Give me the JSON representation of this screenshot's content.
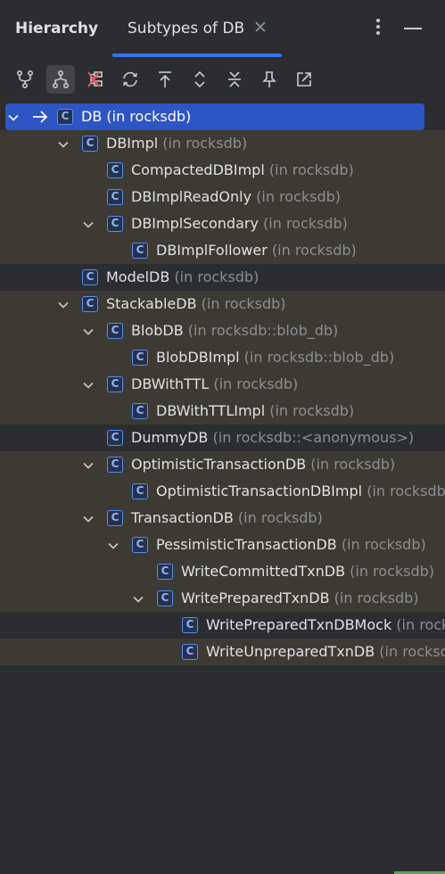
{
  "panel": {
    "title": "Hierarchy",
    "tab_label": "Subtypes of DB",
    "tab_close_icon": "close-icon",
    "more_icon": "more-vertical-icon",
    "minimize_icon": "minimize-icon"
  },
  "toolbar": [
    {
      "name": "supertypes-hierarchy-button",
      "icon": "supertypes-icon",
      "active": false
    },
    {
      "name": "subtypes-hierarchy-button",
      "icon": "subtypes-icon",
      "active": true
    },
    {
      "name": "exclude-class-button",
      "icon": "exclude-icon",
      "active": false
    },
    {
      "name": "refresh-button",
      "icon": "refresh-icon",
      "active": false
    },
    {
      "name": "base-on-this-class-button",
      "icon": "base-on-this-icon",
      "active": false
    },
    {
      "name": "expand-all-button",
      "icon": "expand-all-icon",
      "active": false
    },
    {
      "name": "collapse-all-button",
      "icon": "collapse-all-icon",
      "active": false
    },
    {
      "name": "pin-tab-button",
      "icon": "pin-icon",
      "active": false
    },
    {
      "name": "open-in-editor-button",
      "icon": "export-icon",
      "active": false
    }
  ],
  "tree": [
    {
      "depth": 0,
      "name": "DB",
      "loc": "(in rocksdb)",
      "expanded": true,
      "selected": true,
      "style": "selected"
    },
    {
      "depth": 1,
      "name": "DBImpl",
      "loc": "(in rocksdb)",
      "expanded": true,
      "style": "tinted"
    },
    {
      "depth": 2,
      "name": "CompactedDBImpl",
      "loc": "(in rocksdb)",
      "expanded": null,
      "style": "tinted"
    },
    {
      "depth": 2,
      "name": "DBImplReadOnly",
      "loc": "(in rocksdb)",
      "expanded": null,
      "style": "tinted"
    },
    {
      "depth": 2,
      "name": "DBImplSecondary",
      "loc": "(in rocksdb)",
      "expanded": true,
      "style": "tinted"
    },
    {
      "depth": 3,
      "name": "DBImplFollower",
      "loc": "(in rocksdb)",
      "expanded": null,
      "style": "tinted"
    },
    {
      "depth": 1,
      "name": "ModelDB",
      "loc": "(in rocksdb)",
      "expanded": null,
      "style": "plain"
    },
    {
      "depth": 1,
      "name": "StackableDB",
      "loc": "(in rocksdb)",
      "expanded": true,
      "style": "tinted"
    },
    {
      "depth": 2,
      "name": "BlobDB",
      "loc": "(in rocksdb::blob_db)",
      "expanded": true,
      "style": "tinted"
    },
    {
      "depth": 3,
      "name": "BlobDBImpl",
      "loc": "(in rocksdb::blob_db)",
      "expanded": null,
      "style": "tinted"
    },
    {
      "depth": 2,
      "name": "DBWithTTL",
      "loc": "(in rocksdb)",
      "expanded": true,
      "style": "tinted"
    },
    {
      "depth": 3,
      "name": "DBWithTTLImpl",
      "loc": "(in rocksdb)",
      "expanded": null,
      "style": "tinted"
    },
    {
      "depth": 2,
      "name": "DummyDB",
      "loc": "(in rocksdb::<anonymous>)",
      "expanded": null,
      "style": "plain"
    },
    {
      "depth": 2,
      "name": "OptimisticTransactionDB",
      "loc": "(in rocksdb)",
      "expanded": true,
      "style": "tinted"
    },
    {
      "depth": 3,
      "name": "OptimisticTransactionDBImpl",
      "loc": "(in rocksdb)",
      "expanded": null,
      "style": "tinted"
    },
    {
      "depth": 2,
      "name": "TransactionDB",
      "loc": "(in rocksdb)",
      "expanded": true,
      "style": "tinted"
    },
    {
      "depth": 3,
      "name": "PessimisticTransactionDB",
      "loc": "(in rocksdb)",
      "expanded": true,
      "style": "tinted"
    },
    {
      "depth": 4,
      "name": "WriteCommittedTxnDB",
      "loc": "(in rocksdb)",
      "expanded": null,
      "style": "tinted"
    },
    {
      "depth": 4,
      "name": "WritePreparedTxnDB",
      "loc": "(in rocksdb)",
      "expanded": true,
      "style": "tinted"
    },
    {
      "depth": 5,
      "name": "WritePreparedTxnDBMock",
      "loc": "(in rocksdb)",
      "expanded": null,
      "style": "plain"
    },
    {
      "depth": 5,
      "name": "WriteUnpreparedTxnDB",
      "loc": "(in rocksdb)",
      "expanded": null,
      "style": "tinted"
    }
  ],
  "colors": {
    "background": "#2b2d30",
    "row_tint": "#3c3a32",
    "selection": "#2e55c4",
    "accent": "#3574f0",
    "class_icon": "#5a8def",
    "secondary_text": "#8c8f94"
  },
  "class_icon_letter": "C"
}
